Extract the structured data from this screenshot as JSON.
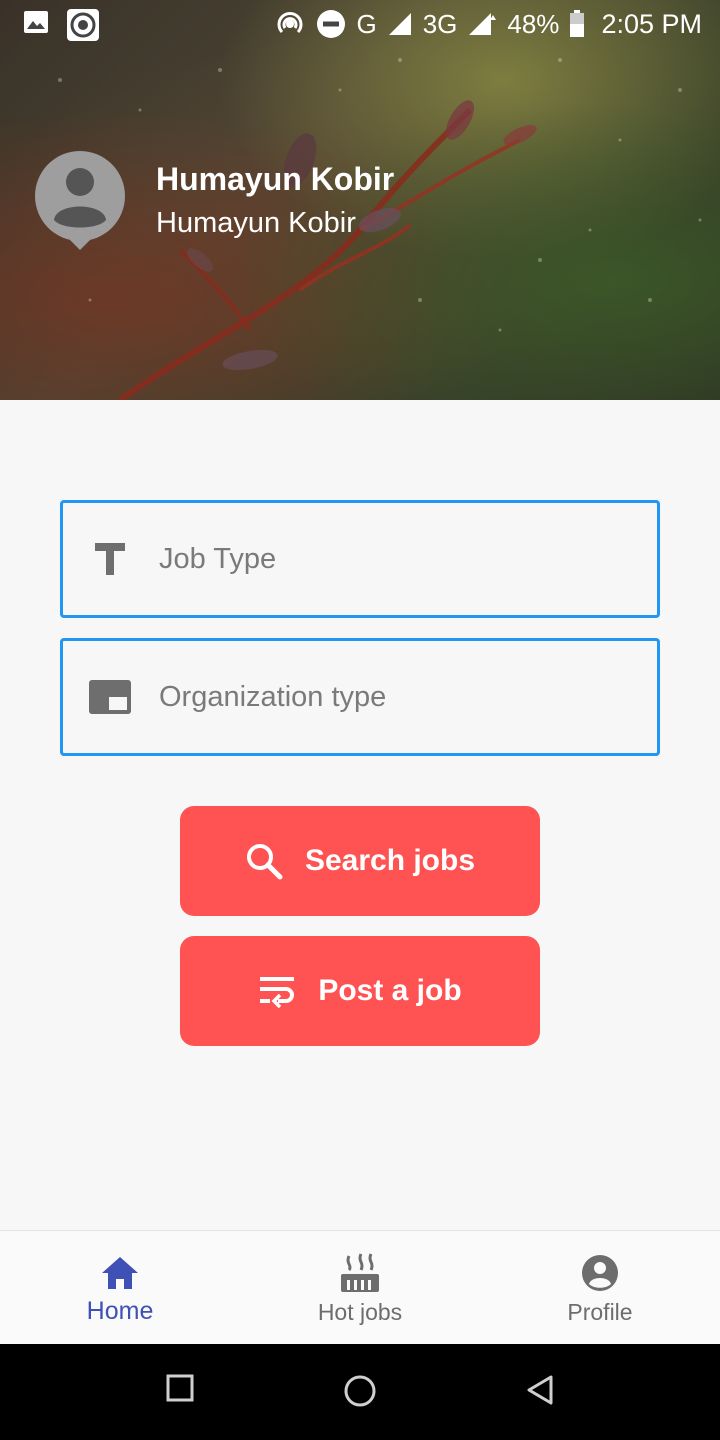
{
  "status_bar": {
    "network": "G",
    "network2": "3G",
    "battery": "48%",
    "time": "2:05 PM"
  },
  "header": {
    "name": "Humayun Kobir",
    "subtitle": "Humayun Kobir"
  },
  "form": {
    "job_type_placeholder": "Job Type",
    "org_type_placeholder": "Organization type"
  },
  "actions": {
    "search_label": "Search jobs",
    "post_label": "Post a job"
  },
  "bottom_nav": {
    "items": [
      {
        "label": "Home",
        "icon": "home-icon",
        "active": true
      },
      {
        "label": "Hot jobs",
        "icon": "hot-jobs-icon",
        "active": false
      },
      {
        "label": "Profile",
        "icon": "account-circle-icon",
        "active": false
      }
    ]
  },
  "colors": {
    "accent": "#ff5252",
    "input_border": "#2196f3",
    "nav_active": "#3f51b5"
  }
}
